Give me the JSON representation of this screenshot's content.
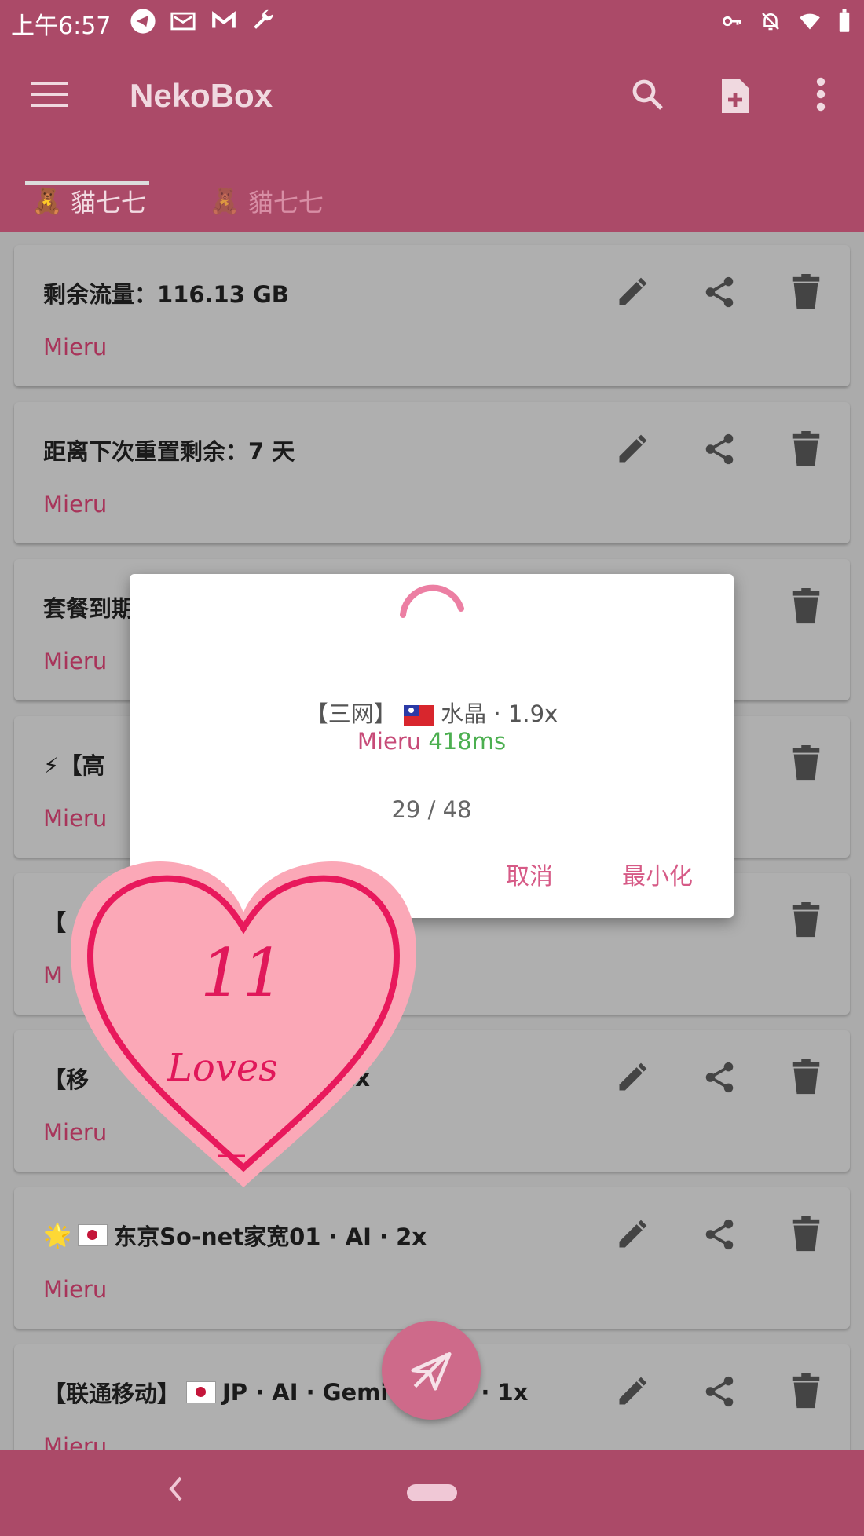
{
  "status_bar": {
    "time": "上午6:57"
  },
  "app_bar": {
    "title": "NekoBox",
    "tabs": [
      {
        "label": "貓七七",
        "selected": true
      },
      {
        "label": "貓七七",
        "selected": false
      }
    ]
  },
  "colors": {
    "primary": "#ab4a68",
    "accent": "#d65a86",
    "latency_ok": "#4caf50"
  },
  "cards": [
    {
      "name": "剩余流量：116.13 GB",
      "group": "Mieru"
    },
    {
      "name": "距离下次重置剩余：7 天",
      "group": "Mieru"
    },
    {
      "name": "套餐到期",
      "group": "Mieru"
    },
    {
      "name": "⚡【高",
      "group": "Mieru"
    },
    {
      "name": "【",
      "group": "M"
    },
    {
      "name": "【移",
      "name_tail": "· 1x",
      "group": "Mieru"
    },
    {
      "name": "东京So-net家宽01 · AI · 2x",
      "prefix": "🌟",
      "flag": "jp",
      "group": "Mieru"
    },
    {
      "name_head": "【联通移动】",
      "name": "JP · AI · Gemi",
      "name_tail": "· 1x",
      "flag": "jp",
      "group": "Mieru"
    }
  ],
  "dialog": {
    "server_prefix": "【三网】",
    "server_name": "水晶 · 1.9x",
    "group": "Mieru",
    "latency": "418ms",
    "progress": "29 / 48",
    "progress_value": {
      "done": 29,
      "total": 48
    },
    "cancel_label": "取消",
    "minimize_label": "最小化"
  },
  "sticker": {
    "number": "11",
    "word": "Loves"
  },
  "icons": [
    "menu-icon",
    "search-icon",
    "new-file-icon",
    "more-vert-icon",
    "edit-icon",
    "share-icon",
    "delete-icon",
    "send-icon"
  ]
}
